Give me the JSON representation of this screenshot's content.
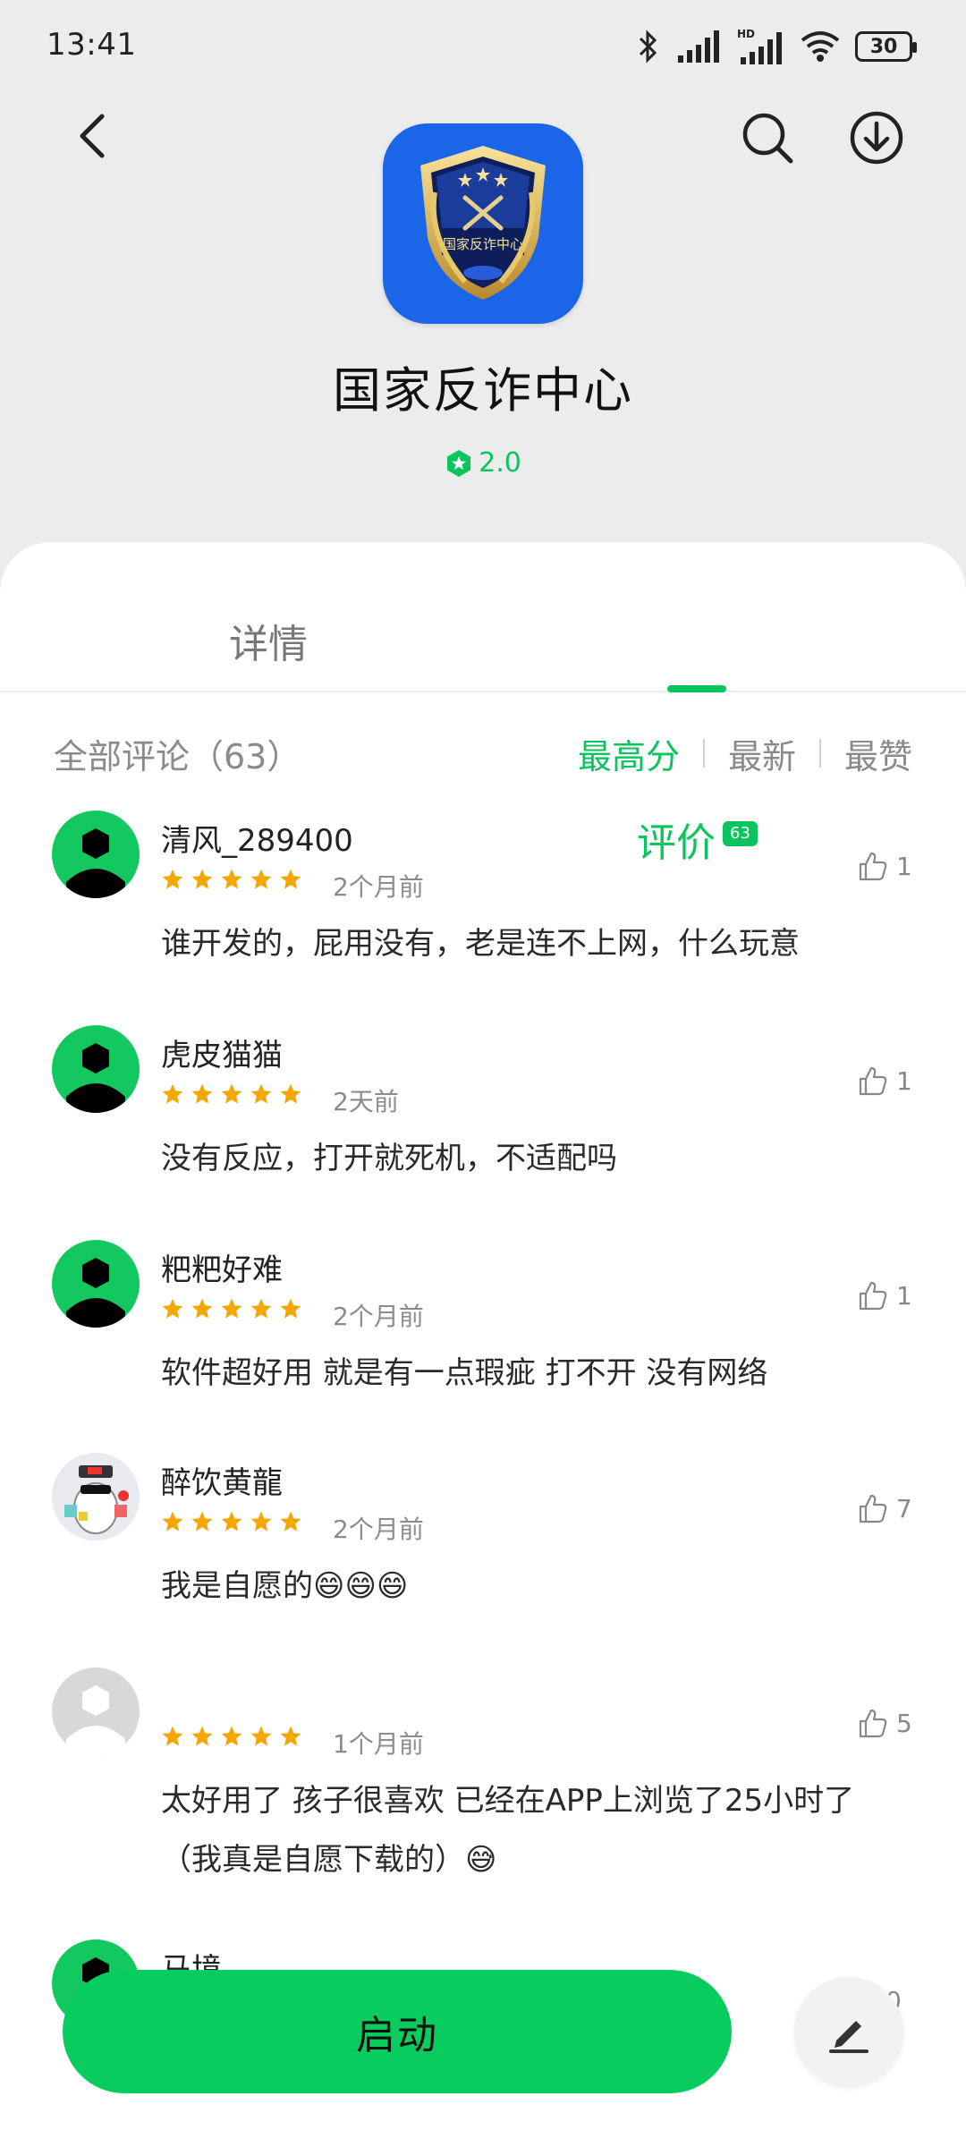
{
  "status_bar": {
    "time": "13:41",
    "battery": "30"
  },
  "app": {
    "title": "国家反诈中心",
    "rating": "2.0",
    "icon_emblem_text": "国家反诈中心"
  },
  "tabs": {
    "details": "详情",
    "reviews": "评价",
    "reviews_count_badge": "63"
  },
  "filters": {
    "all_reviews": "全部评论（63）",
    "sort_highest": "最高分",
    "sort_newest": "最新",
    "sort_most_liked": "最赞"
  },
  "reviews": [
    {
      "name": "清风_289400",
      "when": "2个月前",
      "likes": "1",
      "content": "谁开发的，屁用没有，老是连不上网，什么玩意"
    },
    {
      "name": "虎皮猫猫",
      "when": "2天前",
      "likes": "1",
      "content": "没有反应，打开就死机，不适配吗"
    },
    {
      "name": "粑粑好难",
      "when": "2个月前",
      "likes": "1",
      "content": "软件超好用  就是有一点瑕疵  打不开  没有网络"
    },
    {
      "name": "醉饮黄龍",
      "when": "2个月前",
      "likes": "7",
      "content": "我是自愿的😄😄😄"
    },
    {
      "name": "",
      "when": "1个月前",
      "likes": "5",
      "content": "太好用了 孩子很喜欢 已经在APP上浏览了25小时了（我真是自愿下载的）😅"
    },
    {
      "name": "马境",
      "when": "",
      "likes": "0",
      "content": ""
    }
  ],
  "buttons": {
    "launch": "启动"
  },
  "colors": {
    "accent_green": "#0ac55d",
    "star_orange": "#f5a600",
    "app_icon_blue": "#1b66e8"
  },
  "icons": {
    "back": "chevron-left-icon",
    "search": "search-icon",
    "download": "download-icon",
    "like": "thumbs-up-icon",
    "edit": "edit-pen-icon"
  }
}
